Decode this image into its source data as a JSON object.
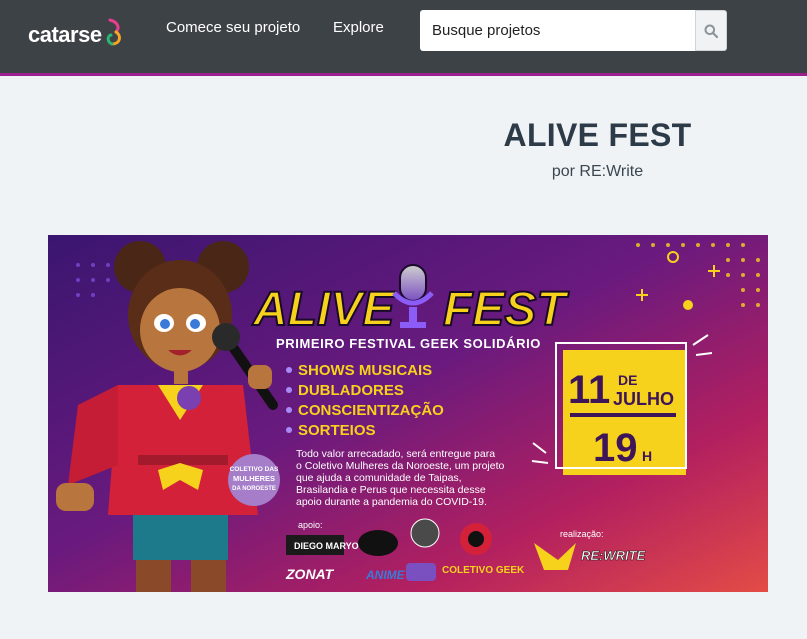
{
  "header": {
    "logo_text": "catarse",
    "nav": {
      "start_project": "Comece seu projeto",
      "explore": "Explore"
    },
    "search": {
      "placeholder": "Busque projetos",
      "icon": "search-icon"
    }
  },
  "project": {
    "title": "ALIVE FEST",
    "author": "por RE:Write"
  },
  "banner": {
    "event_title_left": "ALIVE",
    "event_title_right": "FEST",
    "subtitle": "PRIMEIRO FESTIVAL GEEK SOLIDÁRIO",
    "attractions": [
      "SHOWS MUSICAIS",
      "DUBLADORES",
      "CONSCIENTIZAÇÃO",
      "SORTEIOS"
    ],
    "date_day": "11",
    "date_de": "DE",
    "date_month": "JULHO",
    "date_hour": "19",
    "date_hour_unit": "H",
    "description_lines": [
      "Todo valor arrecadado, será entregue para",
      "o Coletivo Mulheres da Noroeste, um projeto",
      "que ajuda a comunidade de Taipas,",
      "Brasilandia e Perus que necessita desse",
      "apoio durante a pandemia do COVID-19."
    ],
    "collective_badge": [
      "COLETIVO DAS",
      "MULHERES",
      "DA NOROESTE"
    ],
    "support_label": "apoio:",
    "realization_label": "realização:",
    "sponsors": [
      "DIEGO MARYO",
      "ZONAT",
      "COLETIVO GEEK"
    ],
    "realizers": [
      "RE:WRITE"
    ],
    "colors": {
      "accent_yellow": "#f6d21c",
      "date_purple": "#3d1558",
      "brand_magenta": "#9b1f8f"
    }
  }
}
